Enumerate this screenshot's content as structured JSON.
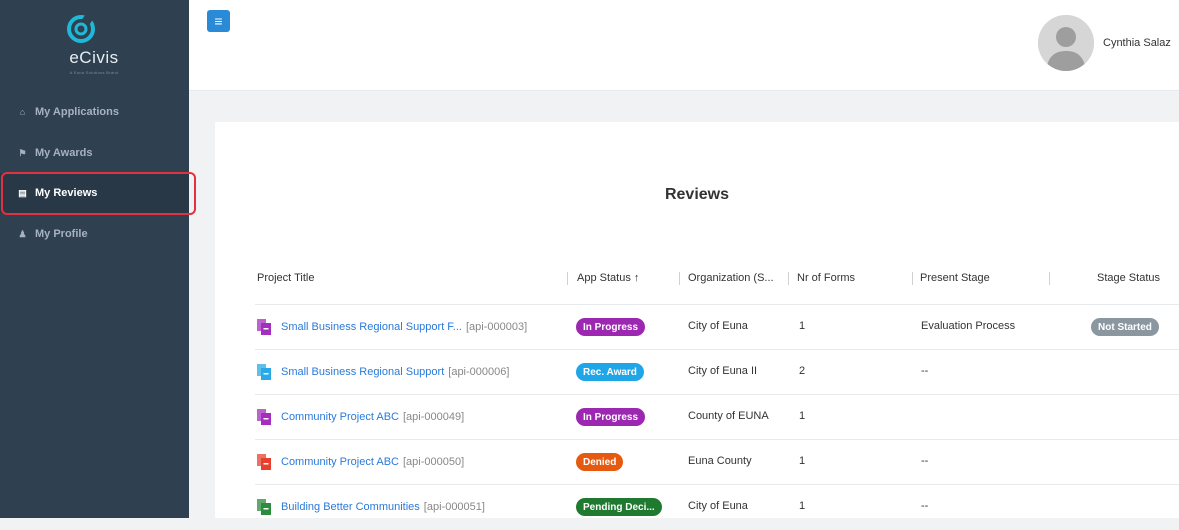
{
  "brand": {
    "name": "eCivis",
    "tagline": "A Euna Solutions Brand",
    "accent": "#1fb8d6"
  },
  "sidebar": {
    "items": [
      {
        "icon": "home-icon",
        "label": "My Applications",
        "glyph": "⌂"
      },
      {
        "icon": "trophy-icon",
        "label": "My Awards",
        "glyph": "⚑"
      },
      {
        "icon": "calendar-icon",
        "label": "My Reviews",
        "glyph": "▤",
        "active": true
      },
      {
        "icon": "user-icon",
        "label": "My Profile",
        "glyph": "♟"
      }
    ]
  },
  "header": {
    "menu_icon": "hamburger-icon",
    "menu_glyph": "≡",
    "user_name": "Cynthia Salaz"
  },
  "reviews": {
    "title": "Reviews",
    "columns": [
      "Project Title",
      "App Status ↑",
      "Organization (S...",
      "Nr of Forms",
      "Present Stage",
      "Stage Status"
    ],
    "rows": [
      {
        "title": "Small Business Regional Support F...",
        "code": "[api-000003]",
        "icon_color": "#a42fbf",
        "status": "In Progress",
        "status_color": "#9c27b0",
        "org": "City of Euna",
        "forms": "1",
        "stage": "Evaluation Process",
        "stage_status": "Not Started",
        "stage_status_color": "#8a97a0"
      },
      {
        "title": "Small Business Regional Support",
        "code": "[api-000006]",
        "icon_color": "#29a9e6",
        "status": "Rec. Award",
        "status_color": "#1fa6e8",
        "org": "City of Euna II",
        "forms": "2",
        "stage": "--",
        "stage_status": "",
        "stage_status_color": ""
      },
      {
        "title": "Community Project ABC",
        "code": "[api-000049]",
        "icon_color": "#a42fbf",
        "status": "In Progress",
        "status_color": "#9c27b0",
        "org": "County of EUNA",
        "forms": "1",
        "stage": "",
        "stage_status": "",
        "stage_status_color": ""
      },
      {
        "title": "Community Project ABC",
        "code": "[api-000050]",
        "icon_color": "#e8402f",
        "status": "Denied",
        "status_color": "#e65a0f",
        "org": "Euna County",
        "forms": "1",
        "stage": "--",
        "stage_status": "",
        "stage_status_color": ""
      },
      {
        "title": "Building Better Communities",
        "code": "[api-000051]",
        "icon_color": "#2e8b3d",
        "status": "Pending Deci...",
        "status_color": "#1f7a30",
        "org": "City of Euna",
        "forms": "1",
        "stage": "--",
        "stage_status": "",
        "stage_status_color": ""
      }
    ]
  }
}
